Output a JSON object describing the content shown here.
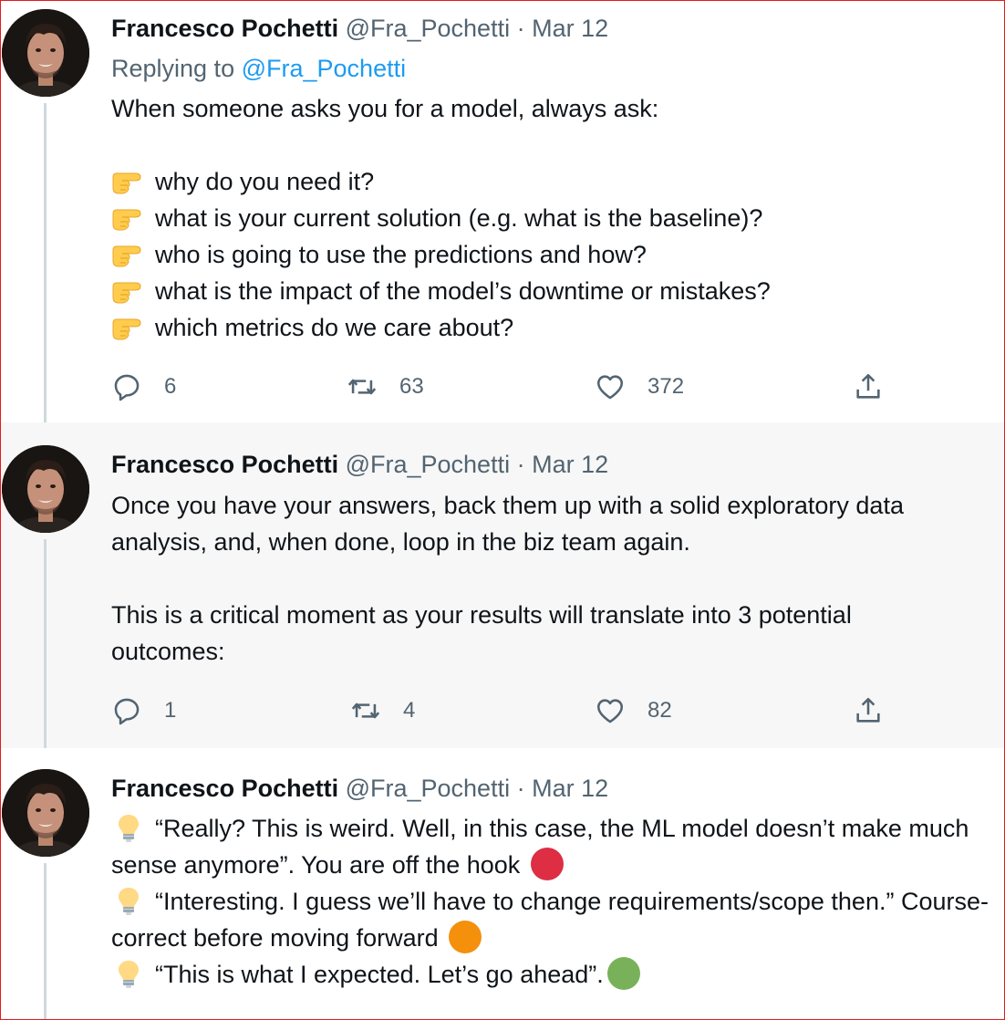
{
  "tweets": [
    {
      "author": "Francesco Pochetti",
      "handle": "@Fra_Pochetti",
      "date": "Mar 12",
      "replying_label": "Replying to",
      "replying_handle": "@Fra_Pochetti",
      "intro": "When someone asks you for a model, always ask:",
      "bullets": [
        "why do you need it?",
        "what is your current solution (e.g. what is the baseline)?",
        "who is going to use the predictions and how?",
        "what is the impact of the model’s downtime or mistakes?",
        "which metrics do we care about?"
      ],
      "replies": "6",
      "retweets": "63",
      "likes": "372"
    },
    {
      "author": "Francesco Pochetti",
      "handle": "@Fra_Pochetti",
      "date": "Mar 12",
      "para1": "Once you have your answers, back them up with a solid exploratory data analysis, and, when done, loop in the biz team again.",
      "para2": "This is a critical moment as your results will translate into 3 potential outcomes:",
      "replies": "1",
      "retweets": "4",
      "likes": "82"
    },
    {
      "author": "Francesco Pochetti",
      "handle": "@Fra_Pochetti",
      "date": "Mar 12",
      "outcomes": [
        {
          "text": "“Really? This is weird. Well, in this case, the ML model doesn’t make much sense anymore”. You are off the hook",
          "dot_color": "#dd2e44"
        },
        {
          "text": "“Interesting. I guess we’ll have to change requirements/scope then.” Course-correct before moving forward",
          "dot_color": "#f4900c"
        },
        {
          "text": "“This is what I expected. Let’s go ahead”.",
          "dot_color": "#78b159"
        }
      ]
    }
  ],
  "separator": "·",
  "icons": {
    "bullet": "backhand-index-pointing-right-icon",
    "outcome": "light-bulb-icon",
    "reply": "reply-icon",
    "retweet": "retweet-icon",
    "like": "heart-icon",
    "share": "share-icon"
  },
  "colors": {
    "text": "#0f1419",
    "secondary": "#536471",
    "link": "#1d9bf0",
    "thread_line": "#cfd9de",
    "highlight_bg": "#f7f7f7",
    "frame": "#e31b1b"
  }
}
